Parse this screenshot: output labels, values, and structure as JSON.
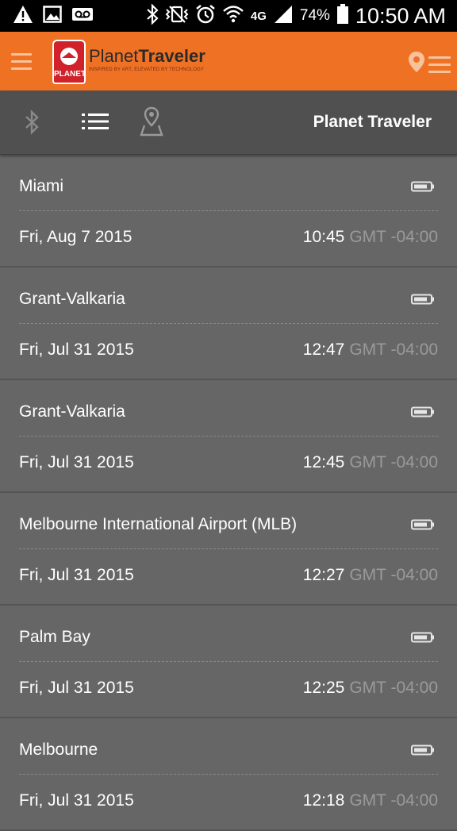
{
  "status_bar": {
    "battery_percent": "74%",
    "time": "10:50 AM",
    "network": "4G",
    "icons": [
      "warning-icon",
      "image-icon",
      "voicemail-icon",
      "bluetooth-icon",
      "vibrate-icon",
      "alarm-icon",
      "wifi-icon",
      "signal-icon",
      "battery-icon"
    ]
  },
  "app_header": {
    "logo_badge": "PLANET",
    "logo_word1": "Planet",
    "logo_word2": "Traveler",
    "tagline": "INSPIRED BY ART, ELEVATED BY TECHNOLOGY",
    "accent_color": "#ef7224",
    "badge_color": "#d1212b"
  },
  "toolbar": {
    "title": "Planet Traveler",
    "icons": [
      "bluetooth-icon",
      "list-icon",
      "map-pin-icon"
    ]
  },
  "entries": [
    {
      "place": "Miami",
      "date": "Fri, Aug 7 2015",
      "time": "10:45",
      "tz": "GMT -04:00"
    },
    {
      "place": "Grant-Valkaria",
      "date": "Fri, Jul 31 2015",
      "time": "12:47",
      "tz": "GMT -04:00"
    },
    {
      "place": "Grant-Valkaria",
      "date": "Fri, Jul 31 2015",
      "time": "12:45",
      "tz": "GMT -04:00"
    },
    {
      "place": "Melbourne International Airport (MLB)",
      "date": "Fri, Jul 31 2015",
      "time": "12:27",
      "tz": "GMT -04:00"
    },
    {
      "place": "Palm Bay",
      "date": "Fri, Jul 31 2015",
      "time": "12:25",
      "tz": "GMT -04:00"
    },
    {
      "place": "Melbourne",
      "date": "Fri, Jul 31 2015",
      "time": "12:18",
      "tz": "GMT -04:00"
    }
  ]
}
